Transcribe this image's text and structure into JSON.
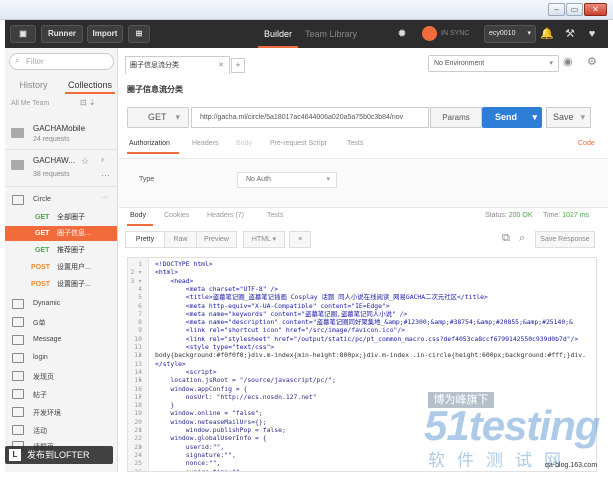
{
  "topbar": {
    "runner": "Runner",
    "import": "Import",
    "tabs": [
      "Builder",
      "Team Library"
    ],
    "sync": "IN SYNC",
    "user": "ecy0010"
  },
  "sidebar": {
    "filter_placeholder": "Filter",
    "tabs": [
      "History",
      "Collections"
    ],
    "filters": "All   Me   Team",
    "collections": [
      {
        "name": "GACHAMobile",
        "count": "24 requests"
      },
      {
        "name": "GACHAW...",
        "count": "38 requests"
      }
    ],
    "circle_folder": "Circle",
    "requests": [
      {
        "method": "GET",
        "title": "全部圈子",
        "color": "#4aa74a"
      },
      {
        "method": "GET",
        "title": "圈子信息...",
        "color": "#ffffff"
      },
      {
        "method": "GET",
        "title": "推荐圈子",
        "color": "#4aa74a"
      },
      {
        "method": "POST",
        "title": "设置用户...",
        "color": "#f08a24"
      },
      {
        "method": "POST",
        "title": "设置圈子...",
        "color": "#f08a24"
      }
    ],
    "folders": [
      "Dynamic",
      "G单",
      "Message",
      "login",
      "发现页",
      "帖子",
      "开发环境",
      "活动",
      "话题页"
    ]
  },
  "main": {
    "tab_title": "圈子信息流分类",
    "request_name": "圈子信息流分类",
    "environment": "No Environment",
    "method": "GET",
    "url": "http://gacha.ml/circle/5a18017ac4644006a020a5a75b0c3b84/nov",
    "params": "Params",
    "send": "Send",
    "save": "Save",
    "request_tabs": [
      "Authorization",
      "Headers",
      "Body",
      "Pre-request Script",
      "Tests"
    ],
    "code_link": "Code",
    "auth_type_label": "Type",
    "auth_type_value": "No Auth",
    "response_tabs": [
      "Body",
      "Cookies",
      "Headers (7)",
      "Tests"
    ],
    "status_label": "Status:",
    "status_value": "200 OK",
    "time_label": "Time:",
    "time_value": "1027 ms",
    "view_buttons": [
      "Pretty",
      "Raw",
      "Preview"
    ],
    "format": "HTML",
    "save_response": "Save Response"
  },
  "code_lines": [
    {
      "n": "1",
      "text": "<!DOCTYPE html>",
      "cls": "tag"
    },
    {
      "n": "2 ▾",
      "text": "<html>",
      "cls": "tag"
    },
    {
      "n": "3 ▾",
      "text": "    <head>",
      "cls": "tag"
    },
    {
      "n": "4",
      "text": "        <meta charset=\"UTF-8\" />",
      "cls": "tag"
    },
    {
      "n": "5",
      "text": "        <title>盗墓笔记圈_盗墓笔记插画 Cosplay 话题 同人小说在线阅读_网易GACHA二次元社区</title>",
      "cls": "tag"
    },
    {
      "n": "6",
      "text": "        <meta http-equiv=\"X-UA-Compatible\" content=\"IE=Edge\">",
      "cls": "tag"
    },
    {
      "n": "7",
      "text": "        <meta name=\"keywords\" content=\"盗墓笔记圈,盗墓笔记同人小说\" />",
      "cls": "tag"
    },
    {
      "n": "8",
      "text": "        <meta name=\"description\" content=\"盗墓笔记圈同好聚集地_&amp;#12300;&amp;#38754;&amp;#20855;&amp;#25140;&",
      "cls": "tag"
    },
    {
      "n": "9",
      "text": "        <link rel=\"shortcut icon\" href=\"/src/image/favicon.ico\"/>",
      "cls": "tag"
    },
    {
      "n": "10",
      "text": "        <link rel=\"stylesheet\" href=\"/output/static/pc/pt_common_macro.css?def4053ca8ccf6799142550c939d0b7d\"/>",
      "cls": "tag"
    },
    {
      "n": "11 ▾",
      "text": "        <style type=\"text/css\">",
      "cls": "tag"
    },
    {
      "n": "12",
      "text": "body{background:#f0f0f0;}div.m-index{min-height:800px;}div.m-index .in-circle{height:600px;background:#fff;}div.",
      "cls": "css"
    },
    {
      "n": "13",
      "text": "</style>",
      "cls": "tag"
    },
    {
      "n": "14 ▾",
      "text": "        <script>",
      "cls": "tag"
    },
    {
      "n": "15",
      "text": "    location.jsRoot = \"/source/javascript/pc/\";",
      "cls": "js"
    },
    {
      "n": "16 ▾",
      "text": "    window.appConfig = {",
      "cls": "js"
    },
    {
      "n": "17",
      "text": "        nosUrl: \"http://ecs.nosdn.127.net\"",
      "cls": "js"
    },
    {
      "n": "18",
      "text": "    }",
      "cls": "js"
    },
    {
      "n": "19",
      "text": "    window.online = \"false\";",
      "cls": "js"
    },
    {
      "n": "20 ▾",
      "text": "    window.neteaseMailUrs={};",
      "cls": "js"
    },
    {
      "n": "21",
      "text": "        window.publishPop = false;",
      "cls": "js"
    },
    {
      "n": "22 ▾",
      "text": "    window.globalUserInfo = {",
      "cls": "js"
    },
    {
      "n": "23",
      "text": "        userid:\"\",",
      "cls": "js"
    },
    {
      "n": "24",
      "text": "        signature:\"\",",
      "cls": "js"
    },
    {
      "n": "25",
      "text": "        nonce:\"\",",
      "cls": "js"
    },
    {
      "n": "26",
      "text": "        expire_time:\"\"",
      "cls": "js"
    }
  ],
  "overlays": {
    "lofter": "发布到LOFTER",
    "wm_top": "博为峰旗下",
    "wm_main": "51testing",
    "wm_sub": "软件测试网",
    "wm_url": "qa-blog.163.com"
  }
}
